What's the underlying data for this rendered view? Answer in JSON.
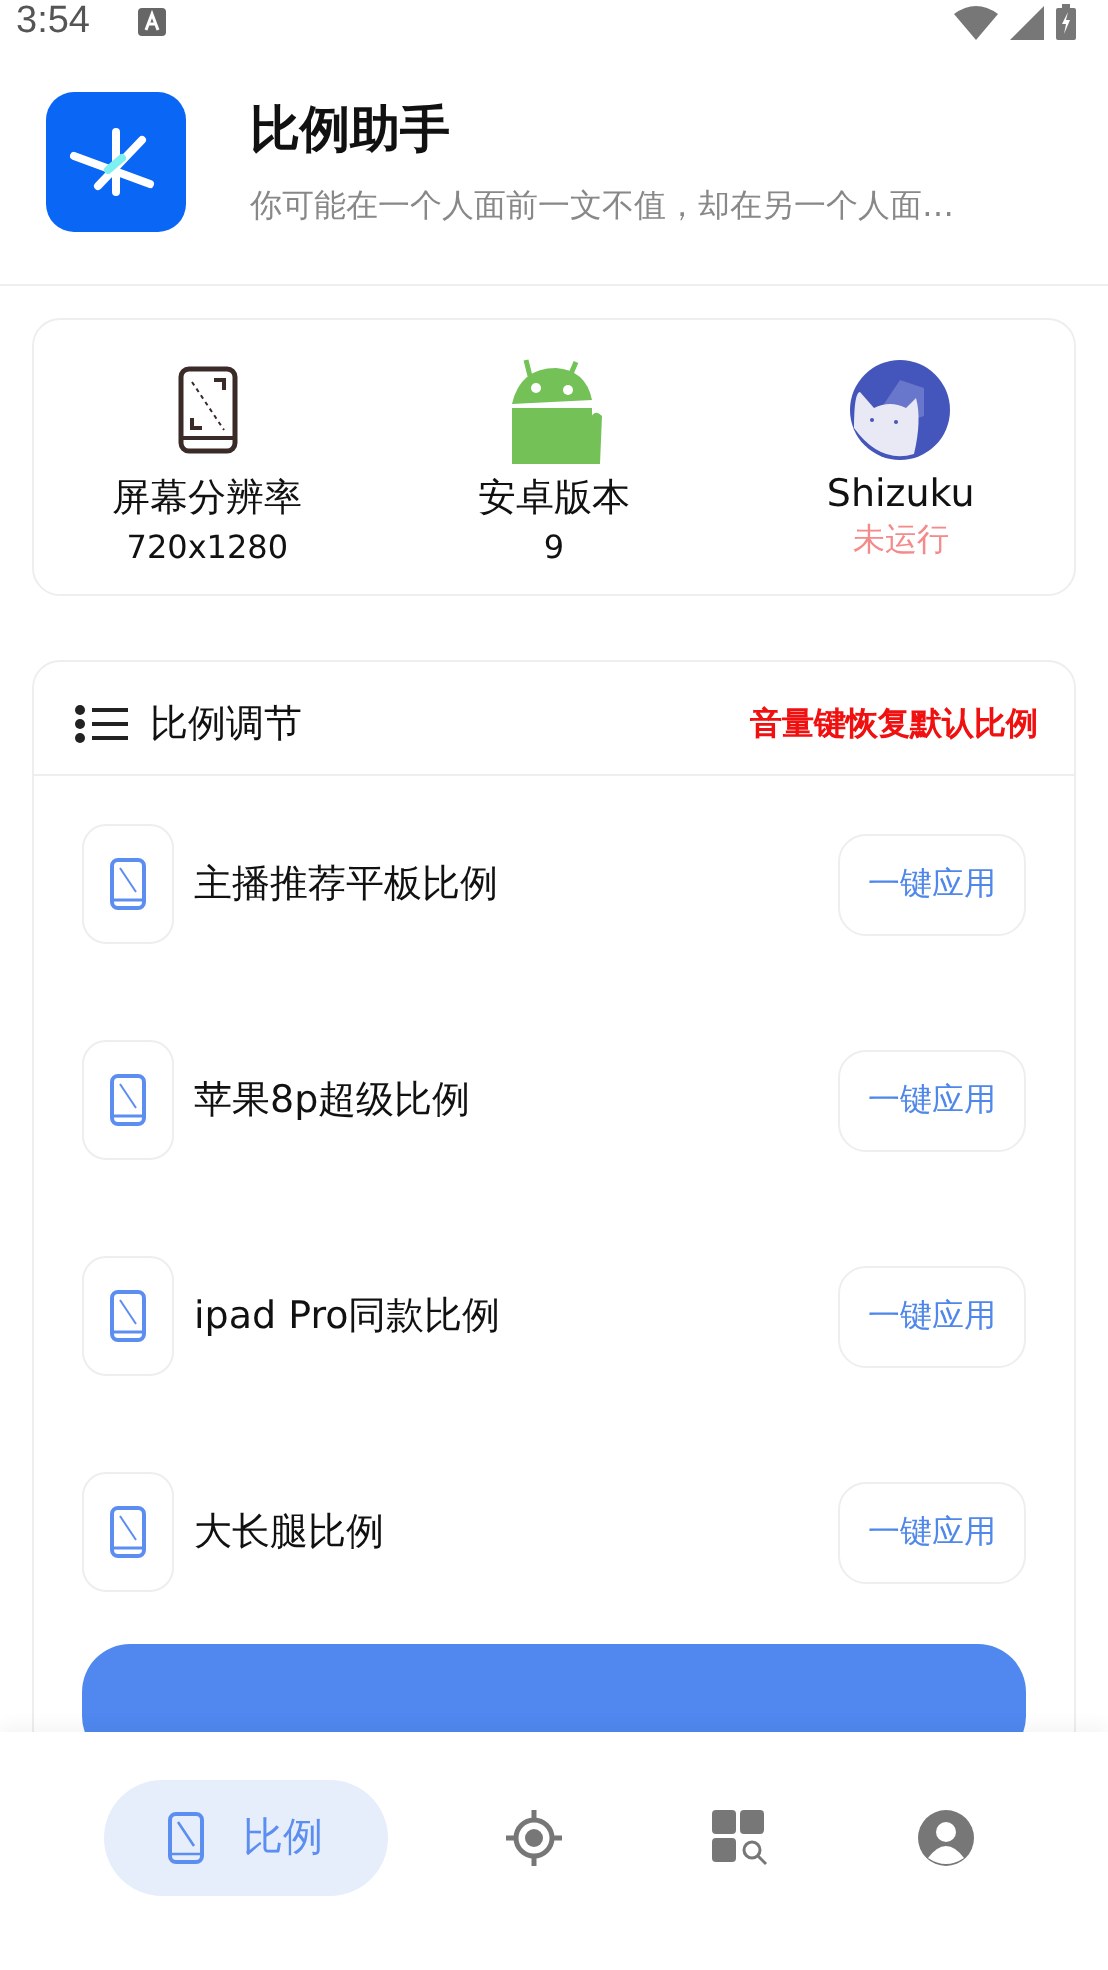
{
  "status_bar": {
    "time": "3:54"
  },
  "app": {
    "title": "比例助手",
    "subtitle": "你可能在一个人面前一文不值，却在另一个人面…"
  },
  "info": [
    {
      "label": "屏幕分辨率",
      "value": "720x1280",
      "warning": false
    },
    {
      "label": "安卓版本",
      "value": "9",
      "warning": false
    },
    {
      "label": "Shizuku",
      "value": "未运行",
      "warning": true
    }
  ],
  "ratio_section": {
    "title": "比例调节",
    "hint": "音量键恢复默认比例",
    "items": [
      {
        "name": "主播推荐平板比例",
        "action": "一键应用"
      },
      {
        "name": "苹果8p超级比例",
        "action": "一键应用"
      },
      {
        "name": "ipad Pro同款比例",
        "action": "一键应用"
      },
      {
        "name": "大长腿比例",
        "action": "一键应用"
      }
    ]
  },
  "nav": [
    {
      "label": "比例",
      "selected": true
    },
    {
      "selected": false
    },
    {
      "selected": false
    },
    {
      "selected": false
    }
  ]
}
